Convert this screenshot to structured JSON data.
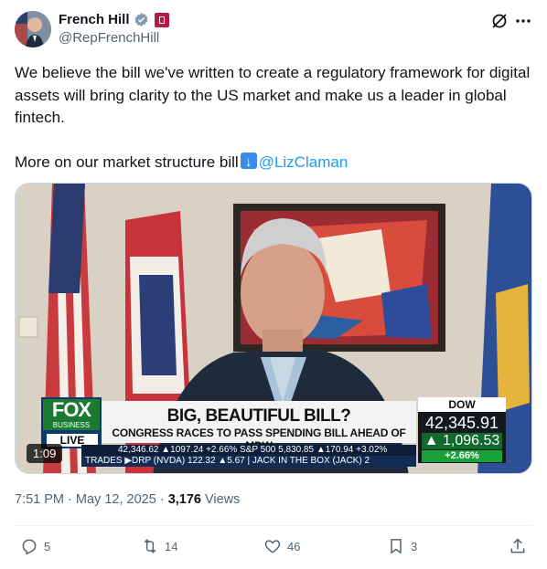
{
  "author": {
    "display_name": "French Hill",
    "handle": "@RepFrenchHill",
    "avatar_icon": "profile-photo",
    "verified_icon": "verified-badge-icon",
    "affiliation_icon": "us-government-badge-icon"
  },
  "header_actions": {
    "grok_icon": "grok-icon",
    "more_icon": "more-horizontal-icon"
  },
  "tweet": {
    "paragraph_1": "We believe the bill we've written to create a regulatory framework for digital assets will bring clarity to the US market and make us a leader in global fintech.",
    "paragraph_2_text": "More on our market structure bill",
    "paragraph_2_emoji": "down-arrow-emoji",
    "mention": "@LizClaman"
  },
  "media": {
    "duration": "1:09",
    "network": {
      "logo_top": "FOX",
      "logo_sub": "BUSINESS",
      "live_label": "LIVE"
    },
    "headline": "BIG, BEAUTIFUL BILL?",
    "subheadline": "CONGRESS RACES TO PASS SPENDING BILL AHEAD OF MDW",
    "dow": {
      "label": "DOW",
      "value": "42,345.91",
      "change": "1,096.53",
      "percent": "+2.66%"
    },
    "ticker_1": "42,346.62 ▲1097.24 +2.66%  S&P 500   5,830.85 ▲170.94 +3.02%",
    "ticker_2": "TRADES  ▶DRP (NVDA)  122.32 ▲5.67  | JACK IN THE BOX (JACK)  2"
  },
  "meta": {
    "time": "7:51 PM",
    "date": "May 12, 2025",
    "separator": "·",
    "views_count": "3,176",
    "views_label": "Views"
  },
  "actions": {
    "reply_count": "5",
    "repost_count": "14",
    "like_count": "46",
    "bookmark_count": "3"
  },
  "colors": {
    "link": "#1d9bf0",
    "secondary_text": "#536471",
    "primary_text": "#0f1419"
  }
}
